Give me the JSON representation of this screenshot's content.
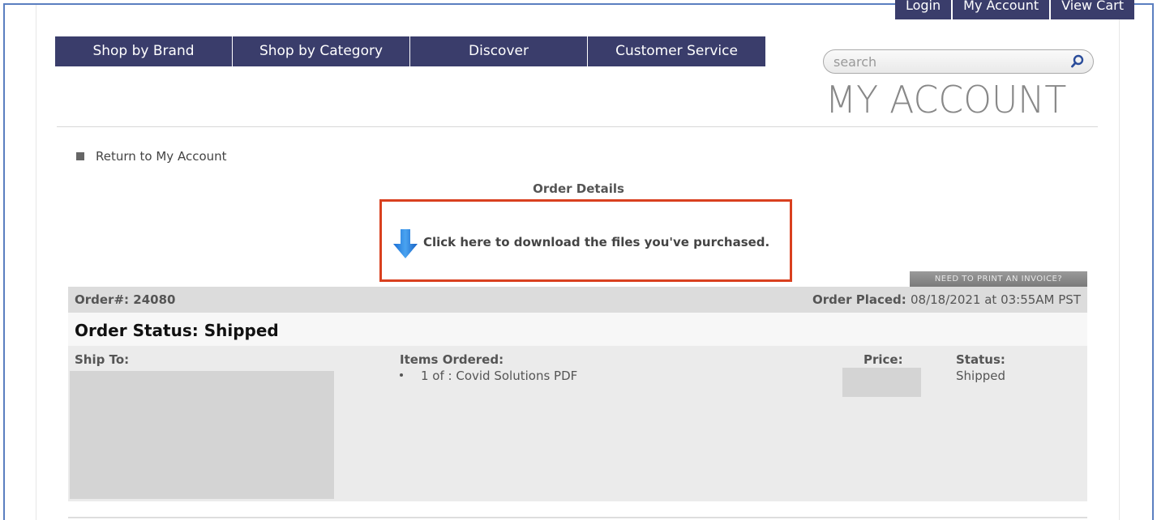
{
  "top_links": [
    "Login",
    "My Account",
    "View Cart"
  ],
  "main_nav": [
    "Shop by Brand",
    "Shop by Category",
    "Discover",
    "Customer Service"
  ],
  "search": {
    "placeholder": "search",
    "icon": "search-icon"
  },
  "page_heading": "MY ACCOUNT",
  "return_link": "Return to My Account",
  "order_details_title": "Order Details",
  "download": {
    "text": "Click here to download the files you've purchased.",
    "icon": "download-arrow-icon"
  },
  "invoice_button": "NEED TO PRINT AN INVOICE?",
  "order": {
    "number_label": "Order#:",
    "number": "24080",
    "placed_label": "Order Placed:",
    "placed_value": "08/18/2021 at 03:55AM PST",
    "status_title": "Order Status: Shipped"
  },
  "details": {
    "ship_to_label": "Ship To:",
    "items_label": "Items Ordered:",
    "items": [
      "1 of : Covid Solutions PDF"
    ],
    "price_label": "Price:",
    "status_label": "Status:",
    "status_value": "Shipped"
  },
  "colors": {
    "nav_bg": "#3a3d6b",
    "highlight_border": "#d9401f",
    "frame_border": "#5b7fc0"
  }
}
